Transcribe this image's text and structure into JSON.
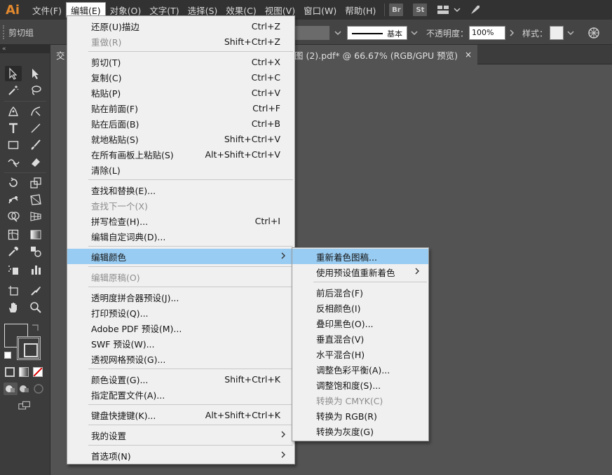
{
  "app": {
    "logo": "Ai",
    "accent": "#e38a2e"
  },
  "menubar": {
    "items": [
      "文件(F)",
      "编辑(E)",
      "对象(O)",
      "文字(T)",
      "选择(S)",
      "效果(C)",
      "视图(V)",
      "窗口(W)",
      "帮助(H)"
    ],
    "active": "编辑(E)",
    "br_label": "Br",
    "st_label": "St"
  },
  "controlbar": {
    "group_label": "剪切组",
    "stroke_profile": "基本",
    "opacity_label": "不透明度：",
    "opacity_value": "100%",
    "style_label": "样式："
  },
  "tabs": {
    "left_partial": "交",
    "doc_title": "图 (2).pdf* @ 66.67% (RGB/GPU 预览)",
    "close": "×"
  },
  "toolbar": {
    "collapse": "«"
  },
  "edit_menu": {
    "items": [
      {
        "label": "还原(U)描边",
        "shortcut": "Ctrl+Z"
      },
      {
        "label": "重做(R)",
        "shortcut": "Shift+Ctrl+Z",
        "disabled": true
      },
      {
        "sep": true
      },
      {
        "label": "剪切(T)",
        "shortcut": "Ctrl+X"
      },
      {
        "label": "复制(C)",
        "shortcut": "Ctrl+C"
      },
      {
        "label": "粘贴(P)",
        "shortcut": "Ctrl+V"
      },
      {
        "label": "贴在前面(F)",
        "shortcut": "Ctrl+F"
      },
      {
        "label": "贴在后面(B)",
        "shortcut": "Ctrl+B"
      },
      {
        "label": "就地粘贴(S)",
        "shortcut": "Shift+Ctrl+V"
      },
      {
        "label": "在所有画板上粘贴(S)",
        "shortcut": "Alt+Shift+Ctrl+V"
      },
      {
        "label": "清除(L)",
        "shortcut": ""
      },
      {
        "sep": true
      },
      {
        "label": "查找和替换(E)...",
        "shortcut": ""
      },
      {
        "label": "查找下一个(X)",
        "shortcut": "",
        "disabled": true
      },
      {
        "label": "拼写检查(H)...",
        "shortcut": "Ctrl+I"
      },
      {
        "label": "编辑自定词典(D)...",
        "shortcut": ""
      },
      {
        "sep": true
      },
      {
        "label": "编辑颜色",
        "shortcut": "",
        "submenu": true,
        "highlight": true
      },
      {
        "sep": true
      },
      {
        "label": "编辑原稿(O)",
        "shortcut": "",
        "disabled": true
      },
      {
        "sep": true
      },
      {
        "label": "透明度拼合器预设(J)...",
        "shortcut": ""
      },
      {
        "label": "打印预设(Q)...",
        "shortcut": ""
      },
      {
        "label": "Adobe PDF 预设(M)...",
        "shortcut": ""
      },
      {
        "label": "SWF 预设(W)...",
        "shortcut": ""
      },
      {
        "label": "透视网格预设(G)...",
        "shortcut": ""
      },
      {
        "sep": true
      },
      {
        "label": "颜色设置(G)...",
        "shortcut": "Shift+Ctrl+K"
      },
      {
        "label": "指定配置文件(A)...",
        "shortcut": ""
      },
      {
        "sep": true
      },
      {
        "label": "键盘快捷键(K)...",
        "shortcut": "Alt+Shift+Ctrl+K"
      },
      {
        "sep": true
      },
      {
        "label": "我的设置",
        "shortcut": "",
        "submenu": true
      },
      {
        "sep": true
      },
      {
        "label": "首选项(N)",
        "shortcut": "",
        "submenu": true
      }
    ]
  },
  "color_submenu": {
    "items": [
      {
        "label": "重新着色图稿...",
        "highlight": true
      },
      {
        "label": "使用预设值重新着色",
        "submenu": true
      },
      {
        "sep": true
      },
      {
        "label": "前后混合(F)"
      },
      {
        "label": "反相颜色(I)"
      },
      {
        "label": "叠印黑色(O)..."
      },
      {
        "label": "垂直混合(V)"
      },
      {
        "label": "水平混合(H)"
      },
      {
        "label": "调整色彩平衡(A)..."
      },
      {
        "label": "调整饱和度(S)..."
      },
      {
        "label": "转换为 CMYK(C)",
        "disabled": true
      },
      {
        "label": "转换为 RGB(R)"
      },
      {
        "label": "转换为灰度(G)"
      }
    ]
  }
}
